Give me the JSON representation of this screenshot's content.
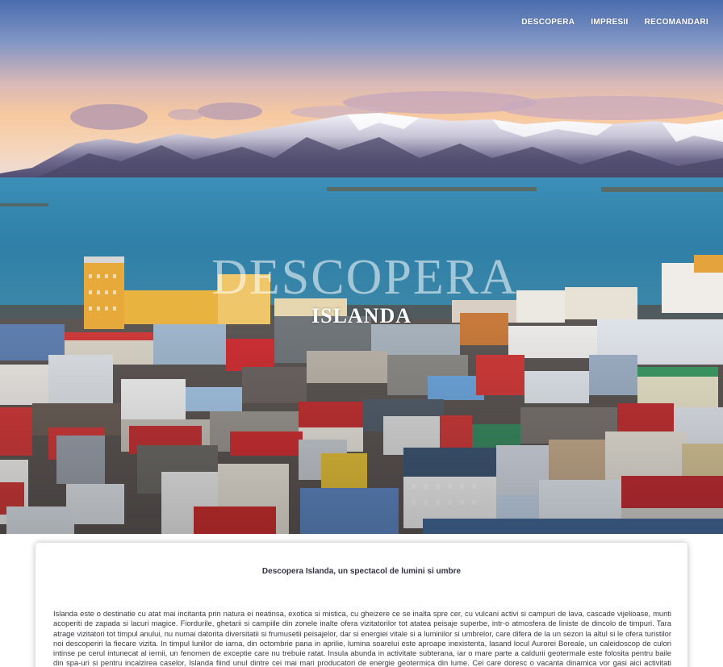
{
  "nav": {
    "items": [
      {
        "label": "DESCOPERA"
      },
      {
        "label": "IMPRESII"
      },
      {
        "label": "RECOMANDARI"
      }
    ]
  },
  "hero": {
    "title": "DESCOPERA",
    "subtitle": "ISLANDA"
  },
  "article": {
    "heading": "Descopera Islanda, un spectacol de lumini si umbre",
    "body": "Islanda este o destinatie cu atat mai incitanta prin natura ei neatinsa, exotica si mistica, cu gheizere ce se inalta spre cer, cu vulcani activi si campuri de lava, cascade vijelioase, munti acoperiti de zapada si lacuri magice. Fiordurile, ghetarii si campiile din zonele inalte ofera vizitatorilor tot atatea peisaje superbe, intr-o atmosfera de liniste de dincolo de timpuri. Tara atrage vizitatori tot timpul anului, nu numai datorita diversitatii si frumusetii peisajelor, dar si energiei vitale si a luminilor si umbrelor, care difera de la un sezon la altul si le ofera turistilor noi descoperiri la fiecare vizita. In timpul lunilor de iarna, din octombrie pana in aprilie, lumina soarelui este aproape inexistenta, lasand locul Aurorei Boreale, un caleidoscop de culori intinse pe cerul intunecat al iernii, un fenomen de exceptie care nu trebuie ratat. Insula abunda in activitate subterana, iar o mare parte a caldurii geotermale este folosita pentru baile din spa-uri si pentru incalzirea caselor, Islanda fiind unul dintre cei mai mari producatori de energie geotermica din lume. Cei care doresc o vacanta dinamica vor gasi aici activitati pentru toate gusturile: snowmobile, echitatie, expeditii"
  },
  "colors": {
    "sky_top": "#4d6fb0",
    "sky_glow": "#f6c9a0",
    "sea": "#2f7fa8",
    "text_dark": "#333344"
  }
}
